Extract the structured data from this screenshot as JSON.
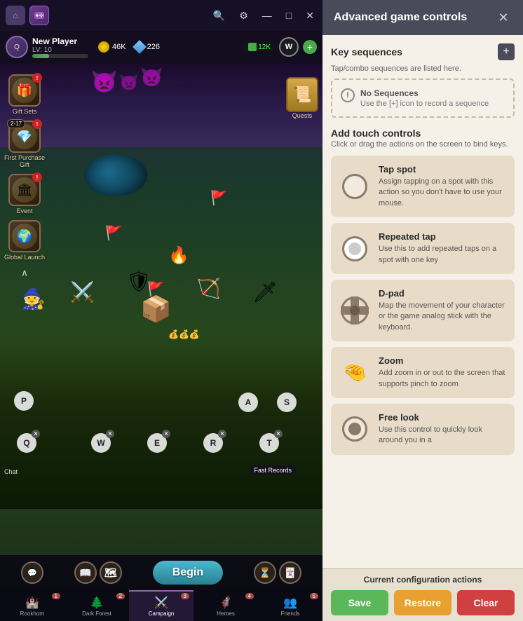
{
  "app": {
    "title": "Advanced game controls"
  },
  "topbar": {
    "home_label": "⌂",
    "game_icon": "🎮",
    "search_icon": "🔍",
    "settings_icon": "⚙",
    "minimize_icon": "—",
    "restore_icon": "□",
    "close_icon": "✕"
  },
  "player": {
    "name": "New Player",
    "level": "LV: 10",
    "currency": "46K",
    "gems": "226",
    "power": "12K",
    "w_key": "W"
  },
  "sidebar": {
    "items": [
      {
        "label": "Gift Sets",
        "icon": "🎁",
        "badge": "!"
      },
      {
        "label": "First Purchase Gift",
        "icon": "💎",
        "badge": "!"
      },
      {
        "label": "Event",
        "icon": "🏛",
        "badge": "!"
      },
      {
        "label": "Global Launch",
        "icon": "🌍",
        "badge": ""
      }
    ]
  },
  "quests": {
    "label": "Quests"
  },
  "map": {
    "keys": [
      "Q",
      "W",
      "E",
      "R",
      "T"
    ],
    "action_keys": [
      "P",
      "A",
      "S"
    ],
    "num_badge": "2-17"
  },
  "bottom_nav": {
    "tabs": [
      {
        "label": "Rookhorn",
        "icon": "🏰",
        "num": "1",
        "active": false
      },
      {
        "label": "Dark Forest",
        "icon": "🌲",
        "num": "2",
        "active": false
      },
      {
        "label": "Campaign",
        "icon": "⚔",
        "num": "3",
        "active": true
      },
      {
        "label": "Heroes",
        "icon": "🦸",
        "num": "4",
        "active": false
      },
      {
        "label": "Friends",
        "icon": "👥",
        "num": "5",
        "active": false
      }
    ],
    "begin_label": "Begin",
    "fast_records_label": "Fast Records",
    "chat_label": "Chat",
    "world_map_label": "World Map"
  },
  "panel": {
    "title": "Advanced game controls",
    "close_label": "✕",
    "key_sequences": {
      "title": "Key sequences",
      "desc": "Tap/combo sequences are listed here.",
      "add_icon": "+",
      "no_seq_title": "No Sequences",
      "no_seq_desc": "Use the [+] icon to record a sequence"
    },
    "touch_controls": {
      "title": "Add touch controls",
      "desc": "Click or drag the actions on the screen to bind keys.",
      "items": [
        {
          "name": "Tap spot",
          "desc": "Assign tapping on a spot with this action so you don't have to use your mouse.",
          "icon_type": "tap"
        },
        {
          "name": "Repeated tap",
          "desc": "Use this to add repeated taps on a spot with one key",
          "icon_type": "repeated"
        },
        {
          "name": "D-pad",
          "desc": "Map the movement of your character or the game analog stick with the keyboard.",
          "icon_type": "dpad"
        },
        {
          "name": "Zoom",
          "desc": "Add zoom in or out to the screen that supports pinch to zoom",
          "icon_type": "zoom"
        },
        {
          "name": "Free look",
          "desc": "Use this control to quickly look around you in a",
          "icon_type": "freelook"
        }
      ]
    },
    "footer": {
      "config_title": "Current configuration actions",
      "save_label": "Save",
      "restore_label": "Restore",
      "clear_label": "Clear"
    }
  }
}
